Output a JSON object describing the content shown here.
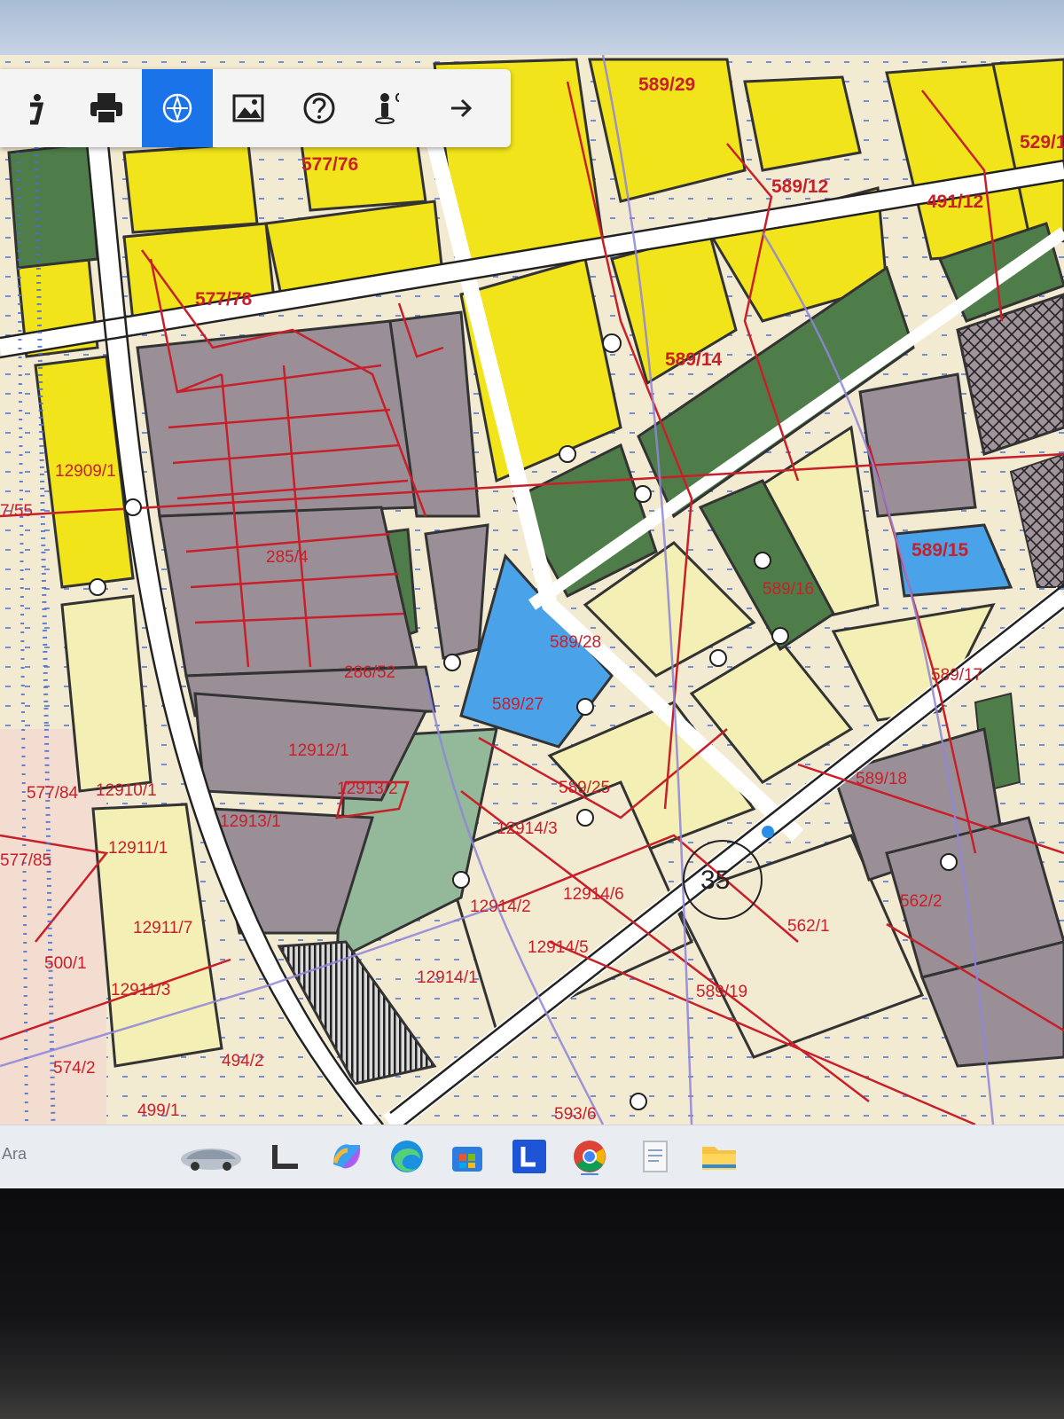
{
  "toolbar": {
    "buttons": [
      {
        "id": "info",
        "icon": "info-icon",
        "active": false
      },
      {
        "id": "print",
        "icon": "printer-icon",
        "active": false
      },
      {
        "id": "compass",
        "icon": "compass-icon",
        "active": true
      },
      {
        "id": "image",
        "icon": "image-icon",
        "active": false
      },
      {
        "id": "help",
        "icon": "help-icon",
        "active": false
      },
      {
        "id": "streetview",
        "icon": "pegman-icon",
        "active": false
      },
      {
        "id": "next",
        "icon": "arrow-right-icon",
        "active": false
      }
    ],
    "accent": "#1a73e8"
  },
  "map": {
    "colors": {
      "residential": "#f2e41b",
      "residential_light": "#f3efb5",
      "commercial": "#9a8f97",
      "green": "#4f7d4a",
      "green_light": "#93b89a",
      "water": "#4aa3e8",
      "parcel_line": "#c8202a",
      "road": "#ffffff"
    },
    "labels": {
      "l1": "589/29",
      "l2": "577/76",
      "l3": "491/12",
      "l4": "529/1",
      "l5": "577/78",
      "l6": "589/14",
      "l7": "12909/1",
      "l8": "589/15",
      "l9": "589/16",
      "l10": "589/28",
      "l11": "589/27",
      "l12": "286/52",
      "l13": "12910/1",
      "l14": "12912/1",
      "l15": "12913/2",
      "l16": "12913/1",
      "l17": "589/25",
      "l18": "12914/3",
      "l19": "12911/1",
      "l20": "12914/2",
      "l21": "12914/6",
      "l22": "12914/1",
      "l23": "577/84",
      "l24": "577/85",
      "l25": "494/2",
      "l26": "499/1",
      "l27": "574/2",
      "l28": "593/6",
      "l29": "562/1",
      "l30": "562/2",
      "l31": "589/19",
      "l32": "589/17",
      "l33": "589/12",
      "l34": "35",
      "l35": "285/4",
      "l36": "7/55",
      "l37": "500/1",
      "l38": "12911/3",
      "l39": "12911/7",
      "l40": "12914/5",
      "l41": "589/18"
    }
  },
  "taskbar": {
    "search_label": "Ara",
    "apps": [
      "car-widget-icon",
      "l-app-icon",
      "copilot-icon",
      "edge-icon",
      "store-icon",
      "l-blue-app-icon",
      "chrome-icon",
      "document-icon",
      "folder-icon"
    ]
  }
}
